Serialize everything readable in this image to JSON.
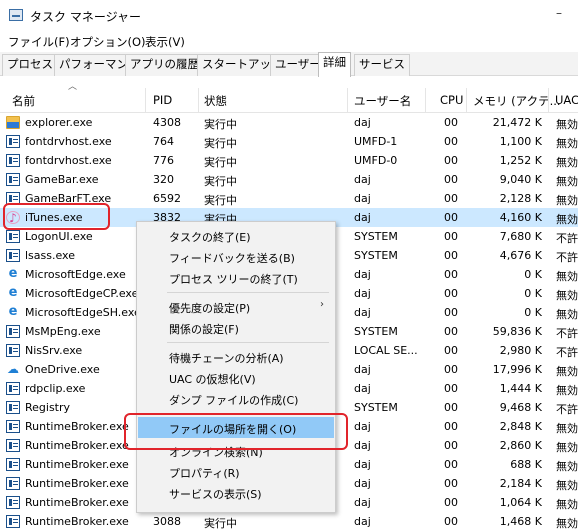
{
  "window": {
    "title": "タスク マネージャー",
    "minimize": "–"
  },
  "menu": [
    "ファイル(F)",
    "オプション(O)",
    "表示(V)"
  ],
  "tabs": [
    "プロセス",
    "パフォーマンス",
    "アプリの履歴",
    "スタートアップ",
    "ユーザー",
    "詳細",
    "サービス"
  ],
  "active_tab": "詳細",
  "columns": {
    "name": "名前",
    "pid": "PID",
    "status": "状態",
    "user": "ユーザー名",
    "cpu": "CPU",
    "mem": "メモリ (アクテ...",
    "uac": "UAC"
  },
  "rows": [
    {
      "name": "explorer.exe",
      "pid": "4308",
      "status": "実行中",
      "user": "daj",
      "cpu": "00",
      "mem": "21,472 K",
      "uac": "無効",
      "icon": "folder-icon"
    },
    {
      "name": "fontdrvhost.exe",
      "pid": "764",
      "status": "実行中",
      "user": "UMFD-1",
      "cpu": "00",
      "mem": "1,100 K",
      "uac": "無効",
      "icon": "exe-icon"
    },
    {
      "name": "fontdrvhost.exe",
      "pid": "776",
      "status": "実行中",
      "user": "UMFD-0",
      "cpu": "00",
      "mem": "1,252 K",
      "uac": "無効",
      "icon": "exe-icon"
    },
    {
      "name": "GameBar.exe",
      "pid": "320",
      "status": "実行中",
      "user": "daj",
      "cpu": "00",
      "mem": "9,040 K",
      "uac": "無効",
      "icon": "exe-icon"
    },
    {
      "name": "GameBarFT.exe",
      "pid": "6592",
      "status": "実行中",
      "user": "daj",
      "cpu": "00",
      "mem": "2,128 K",
      "uac": "無効",
      "icon": "exe-icon"
    },
    {
      "name": "iTunes.exe",
      "pid": "3832",
      "status": "実行中",
      "user": "daj",
      "cpu": "00",
      "mem": "4,160 K",
      "uac": "無効",
      "icon": "itunes-icon",
      "selected": true
    },
    {
      "name": "LogonUI.exe",
      "pid": "",
      "status": "",
      "user": "SYSTEM",
      "cpu": "00",
      "mem": "7,680 K",
      "uac": "不許",
      "icon": "exe-icon"
    },
    {
      "name": "lsass.exe",
      "pid": "",
      "status": "",
      "user": "SYSTEM",
      "cpu": "00",
      "mem": "4,676 K",
      "uac": "不許",
      "icon": "exe-icon"
    },
    {
      "name": "MicrosoftEdge.exe",
      "pid": "",
      "status": "",
      "user": "daj",
      "cpu": "00",
      "mem": "0 K",
      "uac": "無効",
      "icon": "edge-icon"
    },
    {
      "name": "MicrosoftEdgeCP.exe",
      "pid": "",
      "status": "",
      "user": "daj",
      "cpu": "00",
      "mem": "0 K",
      "uac": "無効",
      "icon": "edge-icon"
    },
    {
      "name": "MicrosoftEdgeSH.exe",
      "pid": "",
      "status": "",
      "user": "daj",
      "cpu": "00",
      "mem": "0 K",
      "uac": "無効",
      "icon": "edge-icon"
    },
    {
      "name": "MsMpEng.exe",
      "pid": "",
      "status": "",
      "user": "SYSTEM",
      "cpu": "00",
      "mem": "59,836 K",
      "uac": "不許",
      "icon": "exe-icon"
    },
    {
      "name": "NisSrv.exe",
      "pid": "",
      "status": "",
      "user": "LOCAL SE...",
      "cpu": "00",
      "mem": "2,980 K",
      "uac": "不許",
      "icon": "exe-icon"
    },
    {
      "name": "OneDrive.exe",
      "pid": "",
      "status": "",
      "user": "daj",
      "cpu": "00",
      "mem": "17,996 K",
      "uac": "無効",
      "icon": "onedrive-icon"
    },
    {
      "name": "rdpclip.exe",
      "pid": "",
      "status": "",
      "user": "daj",
      "cpu": "00",
      "mem": "1,444 K",
      "uac": "無効",
      "icon": "exe-icon"
    },
    {
      "name": "Registry",
      "pid": "",
      "status": "",
      "user": "SYSTEM",
      "cpu": "00",
      "mem": "9,468 K",
      "uac": "不許",
      "icon": "exe-icon"
    },
    {
      "name": "RuntimeBroker.exe",
      "pid": "",
      "status": "",
      "user": "daj",
      "cpu": "00",
      "mem": "2,848 K",
      "uac": "無効",
      "icon": "exe-icon"
    },
    {
      "name": "RuntimeBroker.exe",
      "pid": "",
      "status": "",
      "user": "daj",
      "cpu": "00",
      "mem": "2,860 K",
      "uac": "無効",
      "icon": "exe-icon"
    },
    {
      "name": "RuntimeBroker.exe",
      "pid": "",
      "status": "",
      "user": "daj",
      "cpu": "00",
      "mem": "688 K",
      "uac": "無効",
      "icon": "exe-icon"
    },
    {
      "name": "RuntimeBroker.exe",
      "pid": "",
      "status": "",
      "user": "daj",
      "cpu": "00",
      "mem": "2,184 K",
      "uac": "無効",
      "icon": "exe-icon"
    },
    {
      "name": "RuntimeBroker.exe",
      "pid": "",
      "status": "",
      "user": "daj",
      "cpu": "00",
      "mem": "1,064 K",
      "uac": "無効",
      "icon": "exe-icon"
    },
    {
      "name": "RuntimeBroker.exe",
      "pid": "3088",
      "status": "実行中",
      "user": "daj",
      "cpu": "00",
      "mem": "1,468 K",
      "uac": "無効",
      "icon": "exe-icon"
    }
  ],
  "context_menu": {
    "items": [
      {
        "label": "タスクの終了(E)"
      },
      {
        "label": "フィードバックを送る(B)"
      },
      {
        "label": "プロセス ツリーの終了(T)"
      },
      {
        "label": "優先度の設定(P)",
        "submenu": true
      },
      {
        "label": "関係の設定(F)"
      },
      {
        "label": "待機チェーンの分析(A)"
      },
      {
        "label": "UAC の仮想化(V)"
      },
      {
        "label": "ダンプ ファイルの作成(C)"
      },
      {
        "label": "ファイルの場所を開く(O)",
        "highlighted": true
      },
      {
        "label": "オンライン検索(N)"
      },
      {
        "label": "プロパティ(R)"
      },
      {
        "label": "サービスの表示(S)"
      }
    ],
    "submenu_arrow": "›"
  },
  "colors": {
    "selected_row": "#cce8ff",
    "menu_highlight": "#91c9f7",
    "annotation": "#e1242b"
  }
}
